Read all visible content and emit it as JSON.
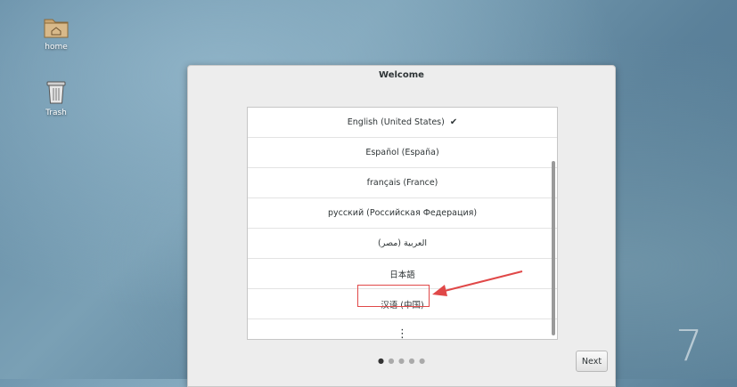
{
  "desktop": {
    "icons": [
      {
        "label": "home",
        "icon": "folder-home-icon"
      },
      {
        "label": "Trash",
        "icon": "trash-icon"
      }
    ]
  },
  "dialog": {
    "title": "Welcome",
    "languages": [
      {
        "label": "English (United States)",
        "selected": true,
        "check": "✔"
      },
      {
        "label": "Español (España)"
      },
      {
        "label": "français (France)"
      },
      {
        "label": "русский (Российская Федерация)"
      },
      {
        "label": "العربية (مصر)"
      },
      {
        "label": "日本語"
      },
      {
        "label": "汉语 (中国)"
      },
      {
        "label": "⋮"
      }
    ],
    "page_indicator": {
      "current": 1,
      "total": 5,
      "active_glyph": "●",
      "inactive_glyph": "●"
    },
    "next_label": "Next"
  },
  "annotation": {
    "highlight_color": "#e04848"
  },
  "os_logo": "7"
}
